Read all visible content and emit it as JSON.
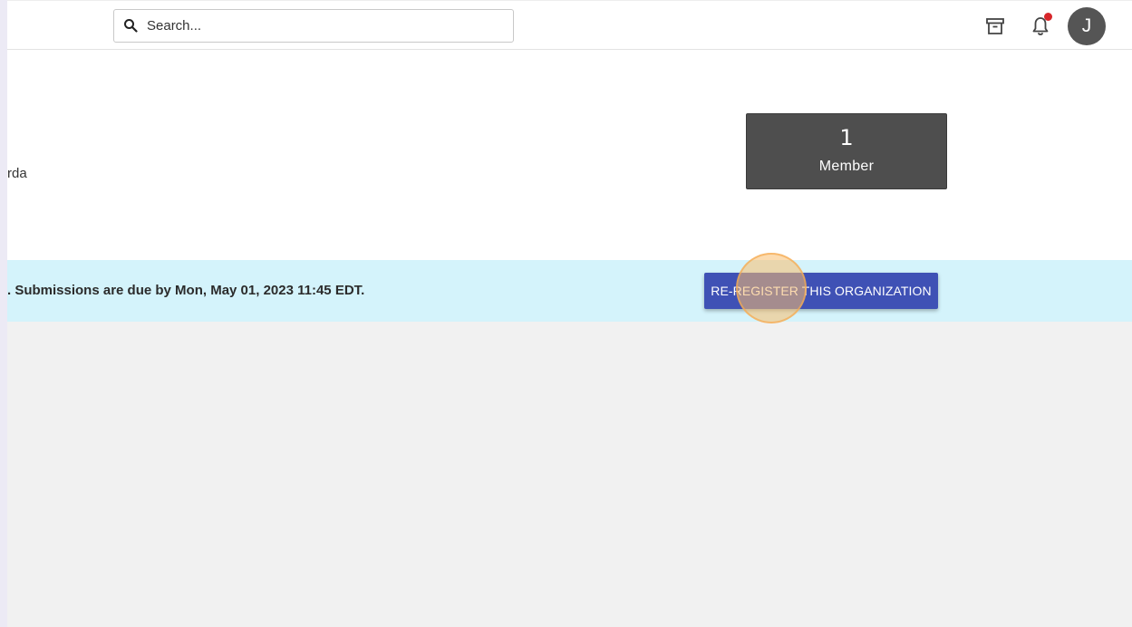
{
  "topbar": {
    "search": {
      "placeholder": "Search..."
    },
    "icons": {
      "search": "search-icon",
      "archive": "archive-icon",
      "notifications": "bell-icon"
    },
    "avatar_initial": "J"
  },
  "header": {
    "org_name_fragment": "rda",
    "member_card": {
      "count": "1",
      "label": "Member"
    }
  },
  "banner": {
    "text": ". Submissions are due by Mon, May 01, 2023 11:45 EDT.",
    "button_label": "RE-REGISTER THIS ORGANIZATION"
  },
  "colors": {
    "primary_button": "#3f51b5",
    "banner_bg": "#d4f3fb",
    "member_card_bg": "#4e4e4e",
    "notification_dot": "#d7262a",
    "avatar_bg": "#555555"
  }
}
